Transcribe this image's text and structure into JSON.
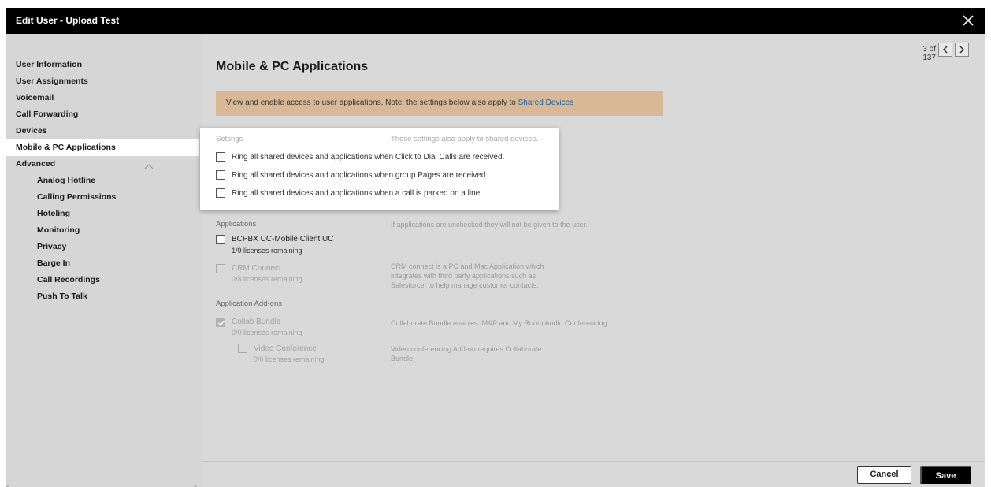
{
  "window": {
    "title": "Edit User - Upload Test",
    "close_icon": "close-icon"
  },
  "sidebar": {
    "items": [
      {
        "label": "User Information"
      },
      {
        "label": "User Assignments"
      },
      {
        "label": "Voicemail"
      },
      {
        "label": "Call Forwarding"
      },
      {
        "label": "Devices"
      },
      {
        "label": "Mobile & PC Applications",
        "active": true
      },
      {
        "label": "Advanced",
        "expanded": true
      }
    ],
    "advanced_items": [
      {
        "label": "Analog Hotline"
      },
      {
        "label": "Calling Permissions"
      },
      {
        "label": "Hoteling"
      },
      {
        "label": "Monitoring"
      },
      {
        "label": "Privacy"
      },
      {
        "label": "Barge In"
      },
      {
        "label": "Call Recordings"
      },
      {
        "label": "Push To Talk"
      }
    ]
  },
  "pager": {
    "text": "3 of 137",
    "prev_icon": "chevron-left-icon",
    "next_icon": "chevron-right-icon"
  },
  "page": {
    "title": "Mobile & PC Applications"
  },
  "banner": {
    "text": "View and enable access to user applications. Note: the settings below also apply to ",
    "link": "Shared Devices"
  },
  "settings": {
    "heading": "Settings",
    "note": "These settings also apply to shared devices.",
    "options": [
      {
        "label": "Ring all shared devices and applications when Click to Dial Calls are received.",
        "checked": false
      },
      {
        "label": "Ring all shared devices and applications when group Pages are received.",
        "checked": false
      },
      {
        "label": "Ring all shared devices and applications when a call is parked on a line.",
        "checked": false
      }
    ]
  },
  "applications": {
    "heading": "Applications",
    "note": "If applications are unchecked they will not be given to the user.",
    "items": [
      {
        "name": "BCPBX UC-Mobile Client UC",
        "licenses": "1/9 licenses remaining",
        "checked": false,
        "enabled": true
      },
      {
        "name": "CRM Connect",
        "licenses": "0/8 licenses remaining",
        "checked": false,
        "enabled": false,
        "description_lines": [
          "CRM connect is a PC and Mac Application which",
          "integrates with third party applications such as",
          "Salesforce, to help manage customer contacts."
        ]
      }
    ]
  },
  "addons": {
    "heading": "Application Add-ons",
    "items": [
      {
        "name": "Collab Bundle",
        "licenses": "0/0 licenses remaining",
        "checked": true,
        "enabled": false,
        "description_lines": [
          "Collaborate Bundle enables IM&P and My Room Audio Conferencing."
        ]
      },
      {
        "name": "Video Conference",
        "licenses": "0/0 licenses remaining",
        "checked": false,
        "enabled": false,
        "description_lines": [
          "Video conferencing Add-on requires Collaborate",
          "Bundle."
        ]
      }
    ]
  },
  "footer": {
    "cancel_label": "Cancel",
    "save_label": "Save"
  }
}
